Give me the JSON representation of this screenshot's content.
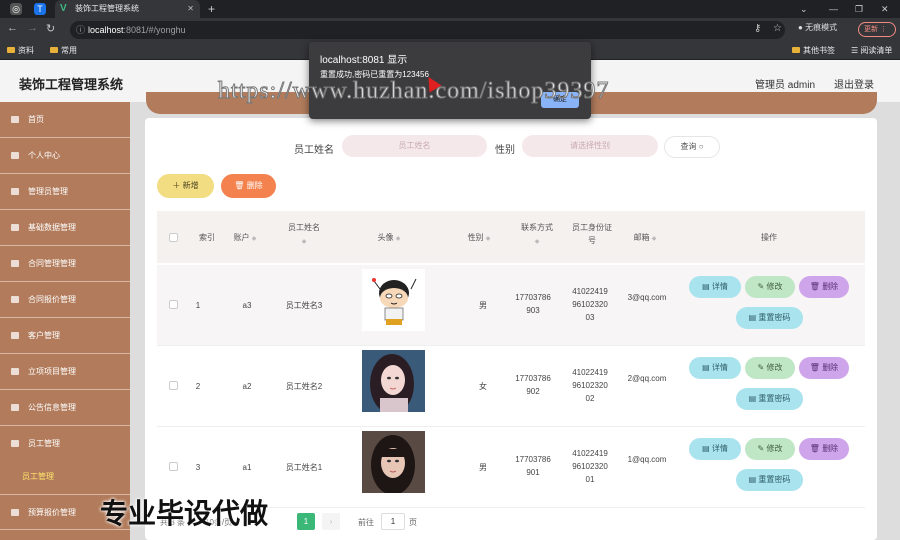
{
  "browser": {
    "tab_title": "装饰工程管理系统",
    "url_host": "localhost",
    "url_path": ":8081/#/yonghu",
    "incognito_label": "无痕模式",
    "update_label": "更新",
    "bookmarks": [
      "资料",
      "常用"
    ],
    "bookmarks_right": [
      "其他书签",
      "阅读清单"
    ]
  },
  "header": {
    "system_title": "装饰工程管理系统",
    "user_label": "管理员 admin",
    "logout_label": "退出登录"
  },
  "sidebar": {
    "items": [
      {
        "label": "首页"
      },
      {
        "label": "个人中心"
      },
      {
        "label": "管理员管理"
      },
      {
        "label": "基础数据管理"
      },
      {
        "label": "合同管理管理"
      },
      {
        "label": "合同报价管理"
      },
      {
        "label": "客户管理"
      },
      {
        "label": "立项项目管理"
      },
      {
        "label": "公告信息管理"
      },
      {
        "label": "员工管理"
      },
      {
        "label": "员工管理"
      },
      {
        "label": "预算报价管理"
      }
    ]
  },
  "search": {
    "name_label": "员工姓名",
    "name_placeholder": "员工姓名",
    "gender_label": "性别",
    "gender_placeholder": "请选择性别",
    "query_label": "查询"
  },
  "actions": {
    "add_label": "新增",
    "delete_label": "删除"
  },
  "table": {
    "headers": {
      "index": "索引",
      "account": "账户",
      "name": "员工姓名",
      "avatar": "头像",
      "gender": "性别",
      "phone": "联系方式",
      "idcard": "员工身份证号",
      "email": "邮箱",
      "ops": "操作"
    },
    "rows": [
      {
        "index": "1",
        "account": "a3",
        "name": "员工姓名3",
        "gender": "男",
        "phone": "17703786903",
        "idcard": "410224199610232003",
        "email": "3@qq.com"
      },
      {
        "index": "2",
        "account": "a2",
        "name": "员工姓名2",
        "gender": "女",
        "phone": "17703786902",
        "idcard": "410224199610232002",
        "email": "2@qq.com"
      },
      {
        "index": "3",
        "account": "a1",
        "name": "员工姓名1",
        "gender": "男",
        "phone": "17703786901",
        "idcard": "410224199610232001",
        "email": "1@qq.com"
      }
    ],
    "btn_detail": "详情",
    "btn_edit": "修改",
    "btn_delete": "删除",
    "btn_reset": "重置密码"
  },
  "pagination": {
    "total_label": "共 3 条",
    "page_size": "10条/页",
    "current_page": "1",
    "goto_label": "前往",
    "goto_value": "1",
    "page_suffix": "页"
  },
  "dialog": {
    "title": "localhost:8081 显示",
    "message": "重置成功,密码已重置为123456",
    "ok_label": "确定"
  },
  "watermarks": {
    "url": "https://www.huzhan.com/ishop39397",
    "slogan": "专业毕设代做"
  }
}
